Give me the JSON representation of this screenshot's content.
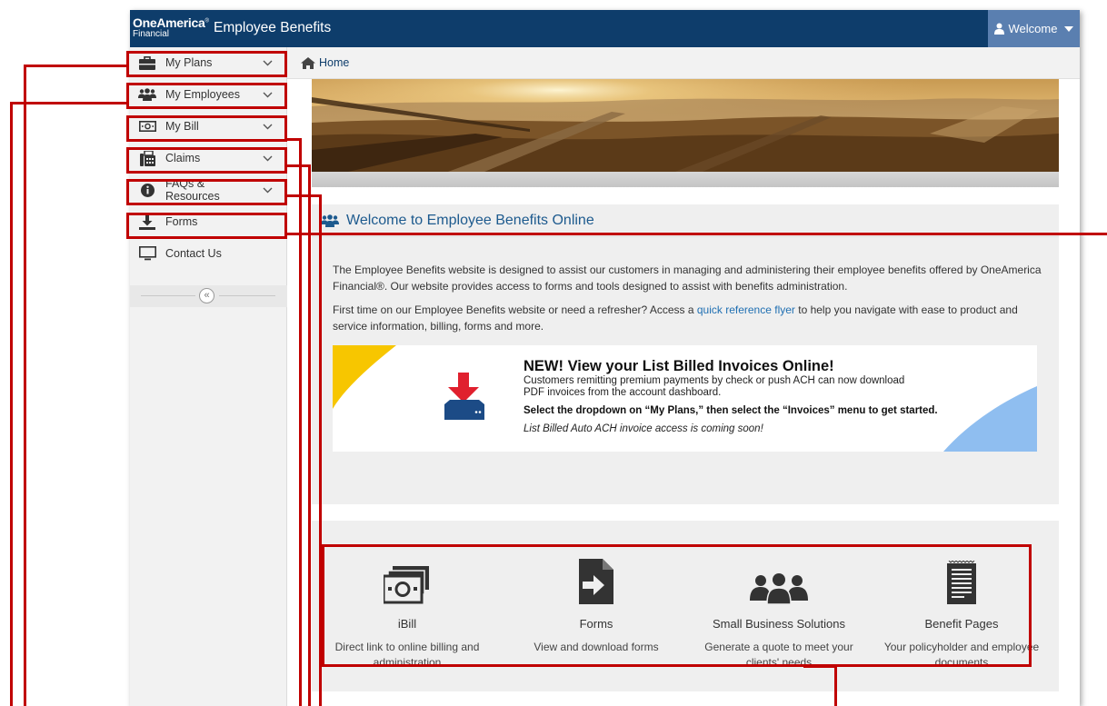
{
  "header": {
    "logo_line1": "OneAmerica",
    "logo_tm": "®",
    "logo_line2": "Financial",
    "app_title": "Employee Benefits",
    "welcome_label": "Welcome"
  },
  "sidebar": {
    "items": [
      {
        "label": "My Plans",
        "icon": "briefcase-icon"
      },
      {
        "label": "My Employees",
        "icon": "users-icon"
      },
      {
        "label": "My Bill",
        "icon": "money-icon"
      },
      {
        "label": "Claims",
        "icon": "fax-icon"
      },
      {
        "label": "FAQs & Resources",
        "icon": "info-circle-icon"
      },
      {
        "label": "Forms",
        "icon": "download-icon"
      },
      {
        "label": "Contact Us",
        "icon": "monitor-icon"
      }
    ],
    "collapse_glyph": "«"
  },
  "breadcrumb": {
    "home": "Home"
  },
  "welcome_panel": {
    "title": "Welcome to Employee Benefits Online",
    "p1": "The Employee Benefits website is designed to assist our customers in managing and administering their employee benefits offered by OneAmerica Financial®. Our website provides access to forms and tools designed to assist with benefits administration.",
    "p2_before": "First time on our Employee Benefits website or need a refresher? Access a ",
    "p2_link": "quick reference flyer",
    "p2_after": " to help you navigate with ease to product and service information, billing, forms and more."
  },
  "promo": {
    "title": "NEW! View your List Billed Invoices Online!",
    "sub": "Customers remitting premium payments by check or push ACH can now download PDF invoices from the account dashboard.",
    "bold": "Select the dropdown on “My Plans,” then select the “Invoices” menu to get started.",
    "italic": "List Billed Auto ACH invoice access is coming soon!"
  },
  "tiles": [
    {
      "title": "iBill",
      "desc": "Direct link to online billing and administration",
      "icon": "bill-stack-icon"
    },
    {
      "title": "Forms",
      "desc": "View and download forms",
      "icon": "form-arrow-icon"
    },
    {
      "title": "Small Business Solutions",
      "desc": "Generate a quote to meet your clients' needs",
      "icon": "group-icon"
    },
    {
      "title": "Benefit Pages",
      "desc": "Your policyholder and employee documents",
      "icon": "document-icon"
    }
  ],
  "colors": {
    "header_bg": "#0e3d6b",
    "welcome_bg": "#5a7fb0",
    "annotation": "#c00000",
    "link": "#1f6fb2"
  }
}
